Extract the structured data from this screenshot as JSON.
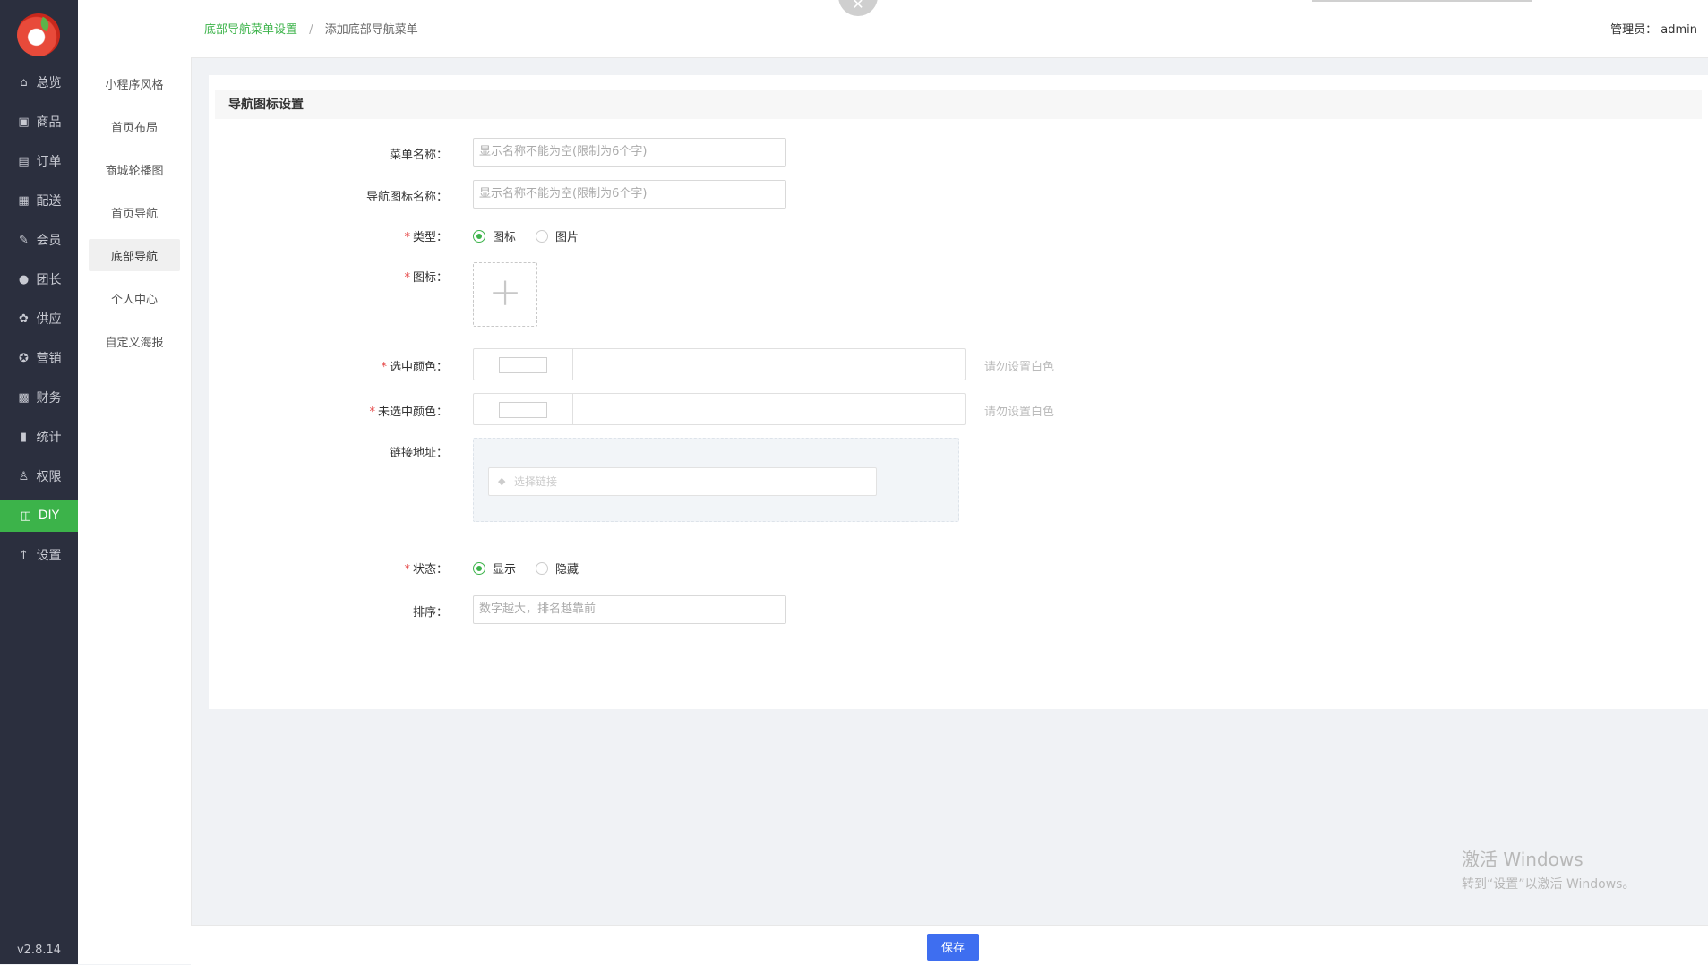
{
  "sidebar": {
    "items": [
      {
        "label": "总览",
        "icon": "home-icon"
      },
      {
        "label": "商品",
        "icon": "product-icon"
      },
      {
        "label": "订单",
        "icon": "clipboard-icon"
      },
      {
        "label": "配送",
        "icon": "delivery-icon"
      },
      {
        "label": "会员",
        "icon": "edit-member-icon"
      },
      {
        "label": "团长",
        "icon": "leader-icon"
      },
      {
        "label": "供应",
        "icon": "supply-icon"
      },
      {
        "label": "营销",
        "icon": "marketing-icon"
      },
      {
        "label": "财务",
        "icon": "finance-icon"
      },
      {
        "label": "统计",
        "icon": "chart-icon"
      },
      {
        "label": "权限",
        "icon": "user-icon"
      },
      {
        "label": "DIY",
        "icon": "layout-icon",
        "active": true
      },
      {
        "label": "设置",
        "icon": "arrow-up-icon"
      }
    ],
    "version": "v2.8.14"
  },
  "subnav": {
    "items": [
      "小程序风格",
      "首页布局",
      "商城轮播图",
      "首页导航",
      "底部导航",
      "个人中心",
      "自定义海报"
    ],
    "active_index": 4
  },
  "header": {
    "breadcrumb_link": "底部导航菜单设置",
    "breadcrumb_sep": "/",
    "breadcrumb_current": "添加底部导航菜单",
    "admin_label": "管理员：",
    "admin_name": "admin"
  },
  "form": {
    "section_title": "导航图标设置",
    "menu_name": {
      "label": "菜单名称：",
      "placeholder": "显示名称不能为空(限制为6个字)"
    },
    "icon_name": {
      "label": "导航图标名称：",
      "placeholder": "显示名称不能为空(限制为6个字)"
    },
    "type": {
      "label": "类型：",
      "options": [
        "图标",
        "图片"
      ],
      "selected": 0
    },
    "icon": {
      "label": "图标：",
      "plus": "+"
    },
    "selected_color": {
      "label": "选中颜色：",
      "hint": "请勿设置白色"
    },
    "unselected_color": {
      "label": "未选中颜色：",
      "hint": "请勿设置白色"
    },
    "link": {
      "label": "链接地址：",
      "placeholder": "选择链接"
    },
    "status": {
      "label": "状态：",
      "options": [
        "显示",
        "隐藏"
      ],
      "selected": 0
    },
    "sort": {
      "label": "排序：",
      "placeholder": "数字越大，排名越靠前"
    },
    "required_mark": "*"
  },
  "footer": {
    "save_label": "保存"
  },
  "watermark": {
    "line1": "激活 Windows",
    "line2": "转到“设置”以激活 Windows。"
  },
  "colors": {
    "accent": "#3cb34a",
    "primary_button": "#3e6ef0",
    "sidebar_bg": "#2b2f3e",
    "required": "#e54545"
  }
}
